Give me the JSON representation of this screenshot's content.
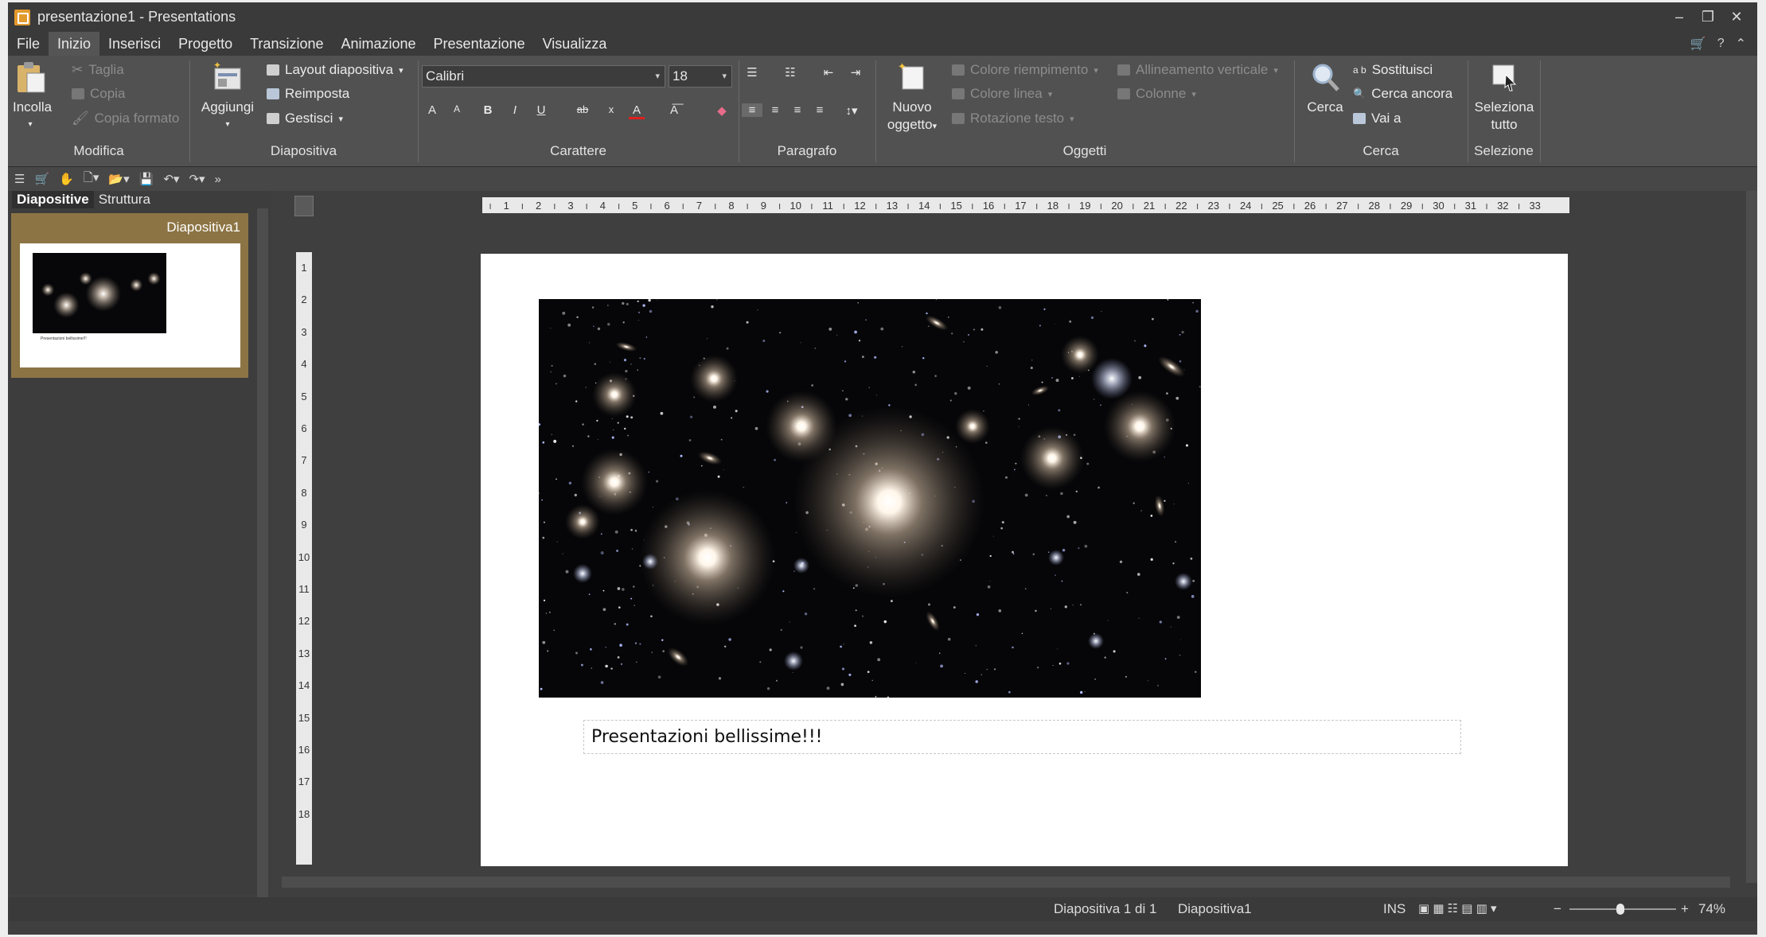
{
  "window": {
    "title": "presentazione1 - Presentations"
  },
  "menu": [
    "File",
    "Inizio",
    "Inserisci",
    "Progetto",
    "Transizione",
    "Animazione",
    "Presentazione",
    "Visualizza"
  ],
  "ribbon": {
    "modifica": {
      "incolla": "Incolla",
      "taglia": "Taglia",
      "copia": "Copia",
      "copia_formato": "Copia formato",
      "label": "Modifica"
    },
    "diapositiva": {
      "aggiungi": "Aggiungi",
      "layout": "Layout diapositiva",
      "reimposta": "Reimposta",
      "gestisci": "Gestisci",
      "label": "Diapositiva"
    },
    "carattere": {
      "font": "Calibri",
      "size": "18",
      "label": "Carattere"
    },
    "paragrafo": {
      "label": "Paragrafo"
    },
    "oggetti": {
      "nuovo_oggetto_line1": "Nuovo",
      "nuovo_oggetto_line2": "oggetto",
      "colore_riempimento": "Colore riempimento",
      "colore_linea": "Colore linea",
      "rotazione_testo": "Rotazione testo",
      "allineamento_verticale": "Allineamento verticale",
      "colonne": "Colonne",
      "label": "Oggetti"
    },
    "cerca": {
      "cerca": "Cerca",
      "sostituisci": "Sostituisci",
      "cerca_ancora": "Cerca ancora",
      "vai_a": "Vai a",
      "label": "Cerca"
    },
    "selezione": {
      "line1": "Seleziona",
      "line2": "tutto",
      "label": "Selezione"
    }
  },
  "panel": {
    "tabs": [
      "Diapositive",
      "Struttura"
    ],
    "thumbnail_name": "Diapositiva1",
    "thumbnail_caption": "Presentazioni bellissime!!!"
  },
  "slide": {
    "text": "Presentazioni bellissime!!!"
  },
  "ruler": {
    "horizontal": [
      "1",
      "2",
      "3",
      "4",
      "5",
      "6",
      "7",
      "8",
      "9",
      "10",
      "11",
      "12",
      "13",
      "14",
      "15",
      "16",
      "17",
      "18",
      "19",
      "20",
      "21",
      "22",
      "23",
      "24",
      "25",
      "26",
      "27",
      "28",
      "29",
      "30",
      "31",
      "32",
      "33"
    ],
    "vertical": [
      "1",
      "2",
      "3",
      "4",
      "5",
      "6",
      "7",
      "8",
      "9",
      "10",
      "11",
      "12",
      "13",
      "14",
      "15",
      "16",
      "17",
      "18"
    ]
  },
  "status": {
    "slide_pos": "Diapositiva 1 di 1",
    "slide_name": "Diapositiva1",
    "mode": "INS",
    "zoom": "74%",
    "zoom_value": 0.74
  },
  "colors": {
    "accent": "#8c7444",
    "window_bg": "#3f3f3f",
    "ribbon_bg": "#515151"
  }
}
